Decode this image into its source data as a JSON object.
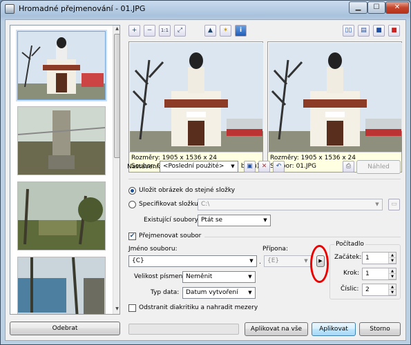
{
  "window": {
    "title": "Hromadné přejmenování - 01.JPG",
    "caption_buttons": [
      "minimize-icon",
      "maximize-icon",
      "close-icon"
    ]
  },
  "toolbar": {
    "left_buttons": [
      "zoom-in-icon",
      "zoom-out-icon",
      "actual-size-icon",
      "fit-icon",
      "histogram-icon",
      "image-edit-icon",
      "info-icon"
    ],
    "right_buttons": [
      "two-panes-icon",
      "layout-icon",
      "single-pane-icon",
      "stop-icon"
    ],
    "zoom_one_to_one": "1:1"
  },
  "previews": [
    {
      "size": "Rozměry: 1905 x 1536 x 24",
      "file": "Soubor: 01.JPG, 1.1 MB (1 206 747 bajtů)"
    },
    {
      "size": "Rozměry: 1905 x 1536 x 24",
      "file": "Soubor: 01.JPG"
    }
  ],
  "settings": {
    "label": "Nastavení:",
    "value": "<Poslední použité>",
    "preview_button": "Náhled"
  },
  "save_same_folder": "Uložit obrázek do stejné složky",
  "specify_folder": {
    "label": "Specifikovat složku:",
    "value": "C:\\"
  },
  "existing_files": {
    "label": "Existující soubory:",
    "value": "Ptát se"
  },
  "rename": {
    "label": "Přejmenovat soubor",
    "checked": true
  },
  "filename": {
    "label": "Jméno souboru:",
    "value": "{C}"
  },
  "extension": {
    "label": "Přípona:",
    "value": "{E}",
    "dot": "."
  },
  "letter_case": {
    "label": "Velikost písmen:",
    "value": "Neměnit"
  },
  "date_type": {
    "label": "Typ data:",
    "value": "Datum vytvoření"
  },
  "remove_diacritics": "Odstranit diakritiku a nahradit mezery",
  "counter": {
    "title": "Počítadlo",
    "start_label": "Začátek:",
    "start": "1",
    "step_label": "Krok:",
    "step": "1",
    "digits_label": "Číslic:",
    "digits": "2"
  },
  "buttons": {
    "remove": "Odebrat",
    "apply_all": "Aplikovat na vše",
    "apply": "Aplikovat",
    "cancel": "Storno"
  },
  "colors": {
    "highlight": "#e00000",
    "accent": "#3c7fb1"
  }
}
